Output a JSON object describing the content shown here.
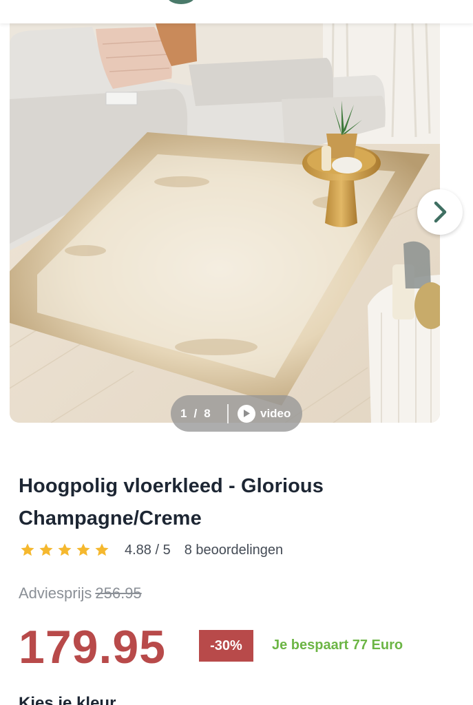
{
  "gallery": {
    "current_index": "1",
    "separator": "/",
    "total": "8",
    "video_label": "video"
  },
  "product": {
    "title_line1": "Hoogpolig vloerkleed - Glorious",
    "title_line2": "Champagne/Creme",
    "rating": "4.88 / 5",
    "rating_value": 4.88,
    "stars_filled": 5,
    "review_count": "8 beoordelingen"
  },
  "pricing": {
    "advice_label": "Adviesprijs",
    "advice_price": "256.95",
    "price": "179.95",
    "discount": "-30%",
    "savings": "Je bespaart 77 Euro"
  },
  "options": {
    "color_heading": "Kies je kleur"
  },
  "colors": {
    "price_red": "#b84a4a",
    "savings_green": "#6cb545",
    "star_yellow": "#f5b82e",
    "brand_green": "#4a7a6a"
  },
  "icons": {
    "next": "chevron-right-icon",
    "play": "play-icon",
    "star": "star-icon"
  }
}
